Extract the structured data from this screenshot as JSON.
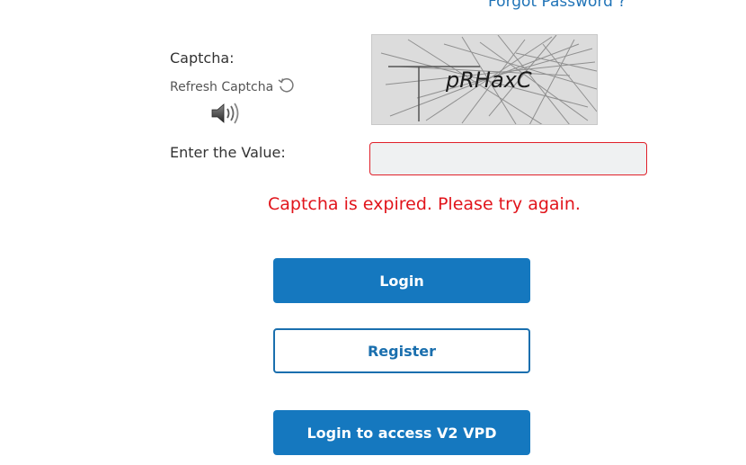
{
  "links": {
    "forgot_password": "Forgot Password ?"
  },
  "captcha": {
    "label": "Captcha:",
    "refresh_label": "Refresh Captcha",
    "image_text": "pRHaxC",
    "value_label": "Enter the Value:",
    "input_value": "",
    "input_placeholder": "",
    "error": "Captcha is expired. Please try again."
  },
  "buttons": {
    "login": "Login",
    "register": "Register",
    "login_v2": "Login to access V2 VPD"
  },
  "colors": {
    "primary": "#1578bf",
    "error": "#e1141b",
    "link": "#1f73b7"
  },
  "icons": {
    "refresh": "refresh-icon",
    "audio": "speaker-icon"
  }
}
